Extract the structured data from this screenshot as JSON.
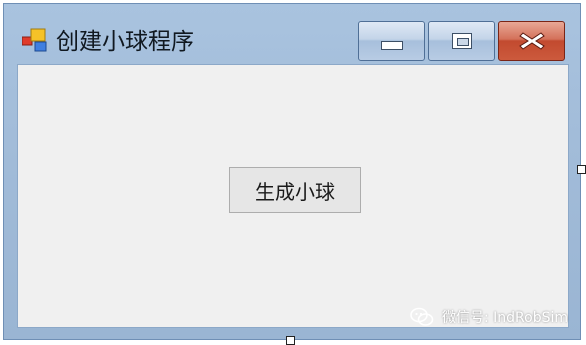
{
  "window": {
    "title": "创建小球程序",
    "icon": "windows-form-icon",
    "controls": {
      "minimize_icon": "minimize-icon",
      "maximize_icon": "maximize-icon",
      "close_icon": "close-icon",
      "close_color": "#c24a2f"
    },
    "frame_color": "#a2bcd9"
  },
  "form": {
    "background": "#f0f0f0",
    "button_label": "生成小球"
  },
  "watermark": {
    "icon": "wechat-icon",
    "text": "微信号: IndRobSim"
  }
}
